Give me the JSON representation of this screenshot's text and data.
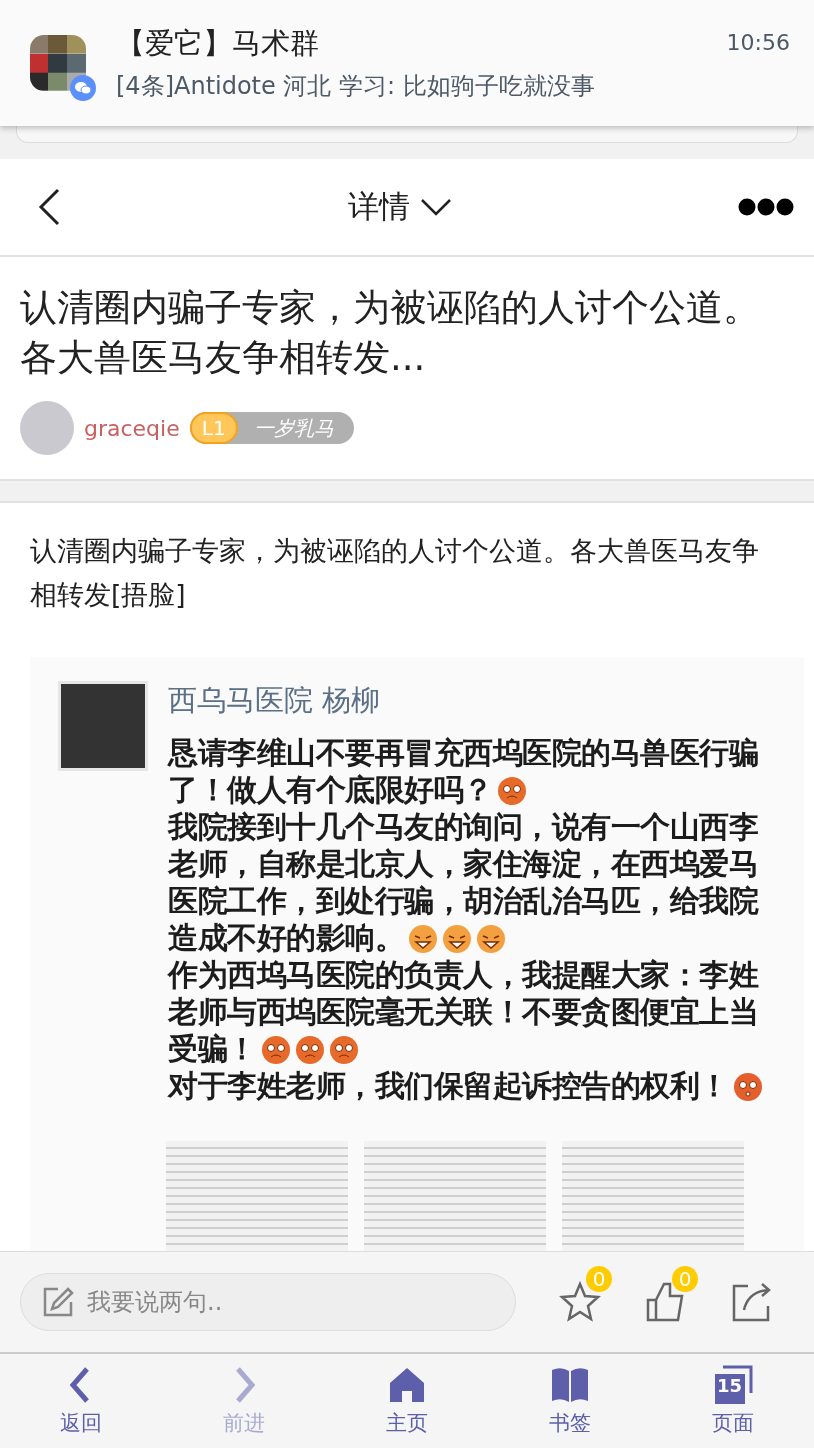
{
  "notification": {
    "title": "【爱它】马术群",
    "message": "[4条]Antidote 河北 学习: 比如驹子吃就没事",
    "time": "10:56"
  },
  "header": {
    "title": "详情"
  },
  "post": {
    "title": "认清圈内骗子专家，为被诬陷的人讨个公道。各大兽医马友争相转发...",
    "author": "graceqie",
    "level": "L1",
    "rank": "一岁乳马",
    "body": "认清圈内骗子专家，为被诬陷的人讨个公道。各大兽医马友争相转发[捂脸]"
  },
  "embedded_post": {
    "name": "西乌马医院 杨柳",
    "lines": [
      {
        "text": "恳请李维山不要再冒充西坞医院的马兽医行骗"
      },
      {
        "text": "了！做人有个底限好吗？",
        "emojis": [
          {
            "kind": "angry"
          }
        ]
      },
      {
        "text": "我院接到十几个马友的询问，说有一个山西李"
      },
      {
        "text": "老师，自称是北京人，家住海淀，在西坞爱马"
      },
      {
        "text": "医院工作，到处行骗，胡治乱治马匹，给我院"
      },
      {
        "text": "造成不好的影响。",
        "emojis": [
          {
            "kind": "laughing"
          },
          {
            "kind": "laughing"
          },
          {
            "kind": "laughing"
          }
        ]
      },
      {
        "text": "作为西坞马医院的负责人，我提醒大家：李姓"
      },
      {
        "text": "老师与西坞医院毫无关联！不要贪图便宜上当"
      },
      {
        "text": "受骗！",
        "emojis": [
          {
            "kind": "angry"
          },
          {
            "kind": "angry"
          },
          {
            "kind": "angry"
          }
        ]
      },
      {
        "text": "对于李姓老师，我们保留起诉控告的权利！",
        "emojis": [
          {
            "kind": "shocked"
          }
        ]
      }
    ]
  },
  "comment_bar": {
    "placeholder": "我要说两句..",
    "favorites": "0",
    "likes": "0"
  },
  "nav": [
    {
      "kind": "back",
      "label": "返回",
      "disabled": false
    },
    {
      "kind": "forward",
      "label": "前进",
      "disabled": true
    },
    {
      "kind": "home",
      "label": "主页",
      "disabled": false
    },
    {
      "kind": "bookmarks",
      "label": "书签",
      "disabled": false
    },
    {
      "kind": "pages",
      "label": "页面",
      "count": "15",
      "disabled": false
    }
  ]
}
